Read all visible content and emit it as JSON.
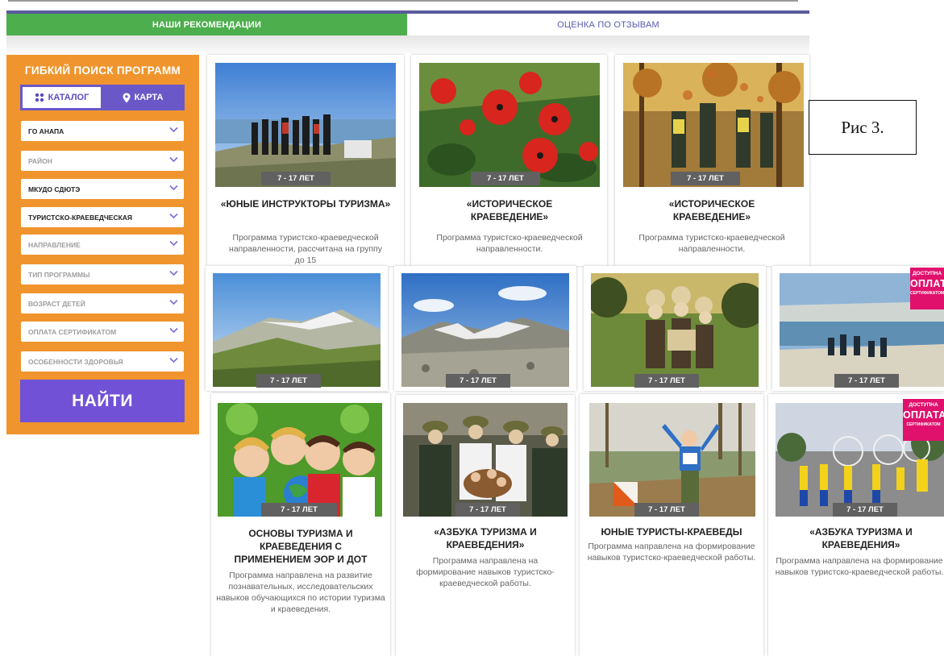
{
  "tabs": {
    "left": "НАШИ РЕКОМЕНДАЦИИ",
    "right": "ОЦЕНКА ПО ОТЗЫВАМ"
  },
  "sidebar": {
    "title": "ГИБКИЙ ПОИСК ПРОГРАММ",
    "catalog_label": "КАТАЛОГ",
    "map_label": "КАРТА",
    "filters": [
      "ГО АНАПА",
      "РАЙОН",
      "МКУДО СДЮТЭ",
      "ТУРИСТСКО-КРАЕВЕДЧЕСКАЯ",
      "НАПРАВЛЕНИЕ",
      "ТИП ПРОГРАММЫ",
      "ВОЗРАСТ ДЕТЕЙ",
      "ОПЛАТА СЕРТИФИКАТОМ",
      "ОСОБЕННОСТИ ЗДОРОВЬЯ"
    ],
    "search_button": "НАЙТИ"
  },
  "age_badge": "7 - 17 ЛЕТ",
  "promo": {
    "line1": "ДОСТУПНА",
    "line2": "ОПЛАТА",
    "line3": "СЕРТИФИКАТОМ"
  },
  "cards_row1": [
    {
      "title": "«ЮНЫЕ ИНСТРУКТОРЫ ТУРИЗМА»",
      "desc": "Программа туристско-краеведческой направленности, рассчитана на группу до 15"
    },
    {
      "title": "«ИСТОРИЧЕСКОЕ КРАЕВЕДЕНИЕ»",
      "desc": "Программа туристско-краеведческой направленности."
    },
    {
      "title": "«ИСТОРИЧЕСКОЕ КРАЕВЕДЕНИЕ»",
      "desc": "Программа туристско-краеведческой направленности."
    }
  ],
  "cards_row3": [
    {
      "title": "ОСНОВЫ ТУРИЗМА И КРАЕВЕДЕНИЯ С ПРИМЕНЕНИЕМ ЭОР И ДОТ",
      "desc": "Программа направлена на развитие познавательных, исследовательских навыков обучающихся по истории туризма и краеведения."
    },
    {
      "title": "«АЗБУКА ТУРИЗМА И КРАЕВЕДЕНИЯ»",
      "desc": "Программа направлена на формирование навыков туристско-краеведческой работы."
    },
    {
      "title": "ЮНЫЕ ТУРИСТЫ-КРАЕВЕДЫ",
      "desc": "Программа направлена на формирование навыков туристско-краеведческой работы."
    },
    {
      "title": "«АЗБУКА ТУРИЗМА И КРАЕВЕДЕНИЯ»",
      "desc": "Программа направлена на формирование навыков туристско-краеведческой работы."
    }
  ],
  "figure_label": "Рис 3.",
  "colors": {
    "accent_purple": "#6a58c8",
    "sidebar_orange": "#f0952d",
    "tab_green": "#4cae4c",
    "promo_pink": "#e0116d"
  }
}
